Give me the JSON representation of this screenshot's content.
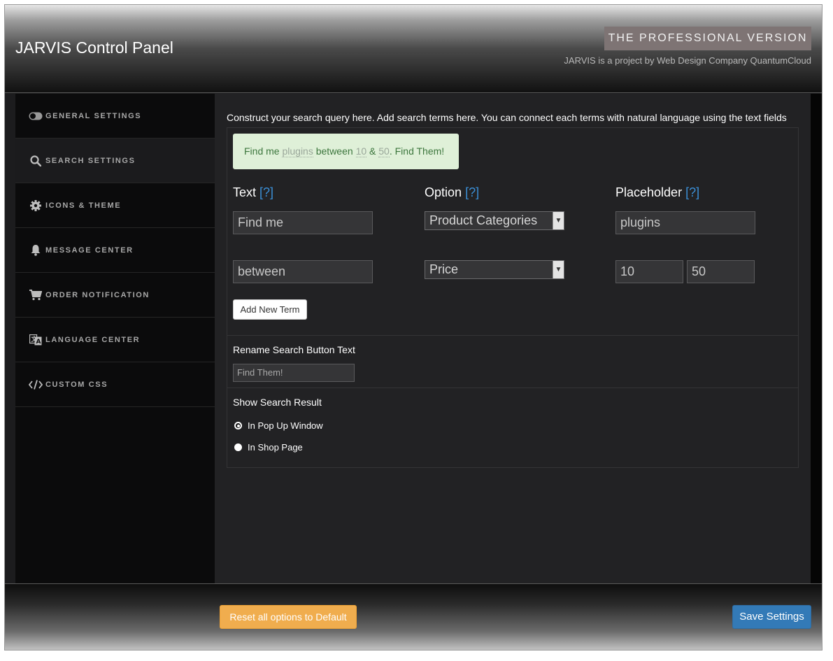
{
  "header": {
    "title": "JARVIS Control Panel",
    "badge": "THE PROFESSIONAL VERSION",
    "byline": "JARVIS is a project by Web Design Company QuantumCloud"
  },
  "sidebar": {
    "items": [
      {
        "label": "GENERAL SETTINGS",
        "icon": "toggle-icon"
      },
      {
        "label": "SEARCH SETTINGS",
        "icon": "search-icon",
        "active": true
      },
      {
        "label": "ICONS & THEME",
        "icon": "gear-icon"
      },
      {
        "label": "MESSAGE CENTER",
        "icon": "bell-icon"
      },
      {
        "label": "ORDER NOTIFICATION",
        "icon": "cart-icon"
      },
      {
        "label": "LANGUAGE CENTER",
        "icon": "language-icon"
      },
      {
        "label": "CUSTOM CSS",
        "icon": "code-icon"
      }
    ]
  },
  "main": {
    "intro": "Construct your search query here. Add search terms here. You can connect each terms with natural language using the text fields",
    "preview": {
      "t1": "Find me ",
      "p1": "plugins",
      "t2": " between ",
      "p2": "10",
      "t3": " & ",
      "p3": "50",
      "t4": ". Find Them!"
    },
    "columns": {
      "text": "Text",
      "option": "Option",
      "placeholder": "Placeholder",
      "help": "[?]"
    },
    "terms": [
      {
        "text": "Find me",
        "option": "Product Categories",
        "placeholder": "plugins"
      },
      {
        "text": "between",
        "option": "Price",
        "placeholder_min": "10",
        "placeholder_max": "50"
      }
    ],
    "add_term_label": "Add New Term",
    "rename_label": "Rename Search Button Text",
    "rename_value": "Find Them!",
    "result_label": "Show Search Result",
    "result_options": [
      {
        "label": "In Pop Up Window",
        "selected": true
      },
      {
        "label": "In Shop Page",
        "selected": false
      }
    ]
  },
  "footer": {
    "reset_label": "Reset all options to Default",
    "save_label": "Save Settings"
  },
  "colors": {
    "accent_help": "#3b8fd6",
    "success_bg": "#dff0d8",
    "success_text": "#3c763d",
    "warning": "#f0ad4e",
    "primary": "#337ab7"
  }
}
